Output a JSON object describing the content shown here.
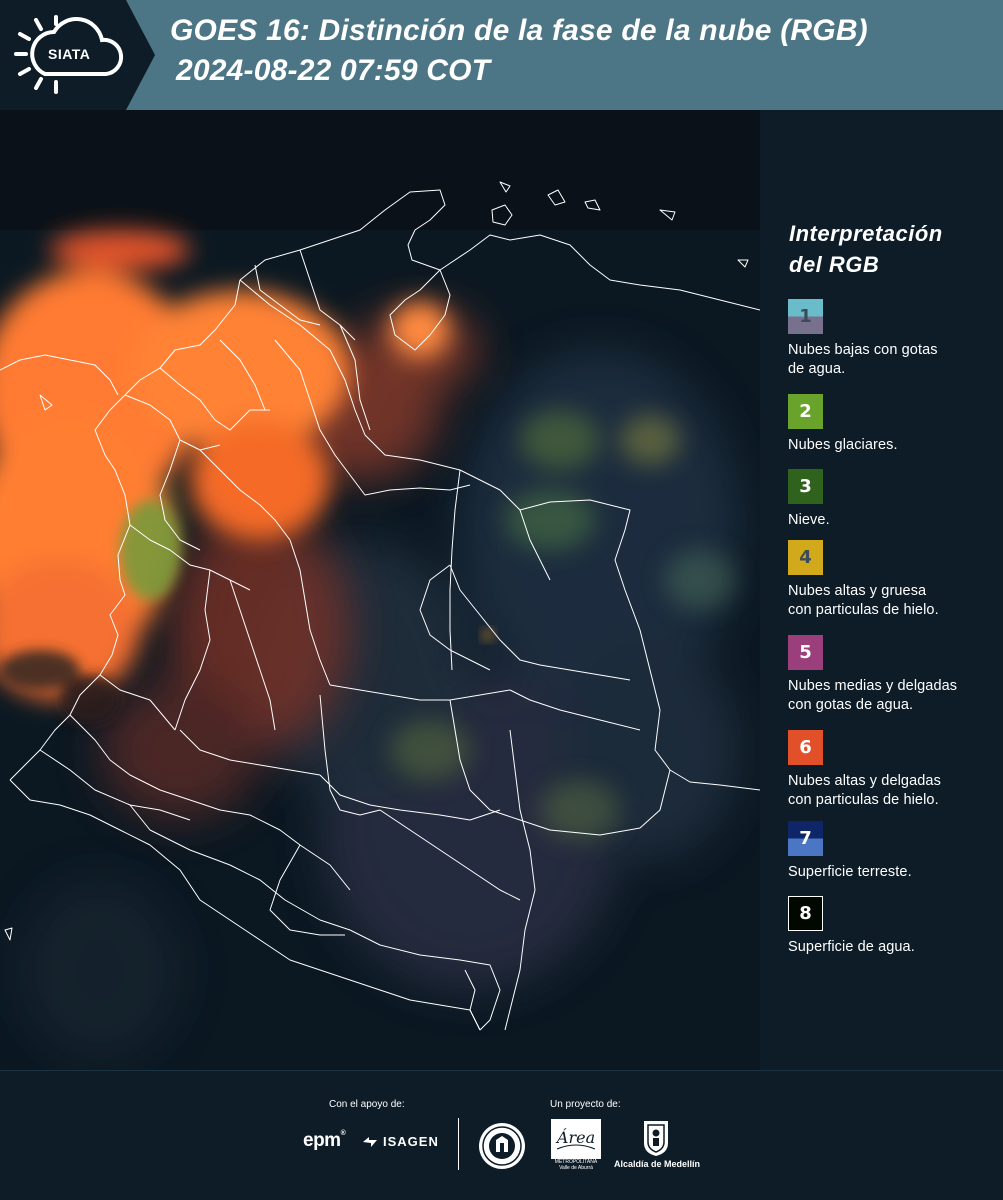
{
  "header": {
    "logo_text": "SIATA",
    "title_line1": "GOES 16: Distinción de la fase de la nube (RGB)",
    "title_line2": "2024-08-22 07:59 COT"
  },
  "legend": {
    "title_line1": "Interpretación",
    "title_line2": "del RGB",
    "items": [
      {
        "number": "1",
        "label_line1": "Nubes bajas con gotas",
        "label_line2": "de agua.",
        "color_top": "#6bbccb",
        "color_bottom": "#78718e",
        "number_color": "#3c4b58"
      },
      {
        "number": "2",
        "label_line1": "Nubes glaciares.",
        "label_line2": "",
        "color_top": "#6aa32c",
        "color_bottom": "#6aa32c",
        "number_color": "#ffffff"
      },
      {
        "number": "3",
        "label_line1": "Nieve.",
        "label_line2": "",
        "color_top": "#2f621d",
        "color_bottom": "#2f621d",
        "number_color": "#ffffff"
      },
      {
        "number": "4",
        "label_line1": "Nubes altas y gruesa",
        "label_line2": "con particulas de hielo.",
        "color_top": "#d1a91a",
        "color_bottom": "#d1a91a",
        "number_color": "#3c4b58"
      },
      {
        "number": "5",
        "label_line1": "Nubes medias y delgadas",
        "label_line2": "con gotas de agua.",
        "color_top": "#9b3f7c",
        "color_bottom": "#9b3f7c",
        "number_color": "#ffffff"
      },
      {
        "number": "6",
        "label_line1": "Nubes altas y delgadas",
        "label_line2": "con particulas de hielo.",
        "color_top": "#e2502a",
        "color_bottom": "#e2502a",
        "number_color": "#ffffff"
      },
      {
        "number": "7",
        "label_line1": "Superficie terreste.",
        "label_line2": "",
        "color_top": "#0e2568",
        "color_bottom": "#4a76c3",
        "number_color": "#ffffff"
      },
      {
        "number": "8",
        "label_line1": "Superficie de agua.",
        "label_line2": "",
        "color_top": "#000800",
        "color_bottom": "#000800",
        "number_color": "#ffffff"
      }
    ]
  },
  "footer": {
    "support_label": "Con el apoyo de:",
    "project_label": "Un proyecto de:",
    "sponsor_1": "epm",
    "sponsor_2": "ISAGEN",
    "partner_area": "Área",
    "partner_area_caption": "METROPOLITANA Valle de Aburrá",
    "partner_alcaldia": "Alcaldía de Medellín"
  },
  "colors": {
    "header_bg": "#4c7685",
    "page_bg": "#0d1c27",
    "cloud_high": "#ff7a30",
    "cloud_mid": "#c4452a",
    "boundary": "#ffffff"
  }
}
